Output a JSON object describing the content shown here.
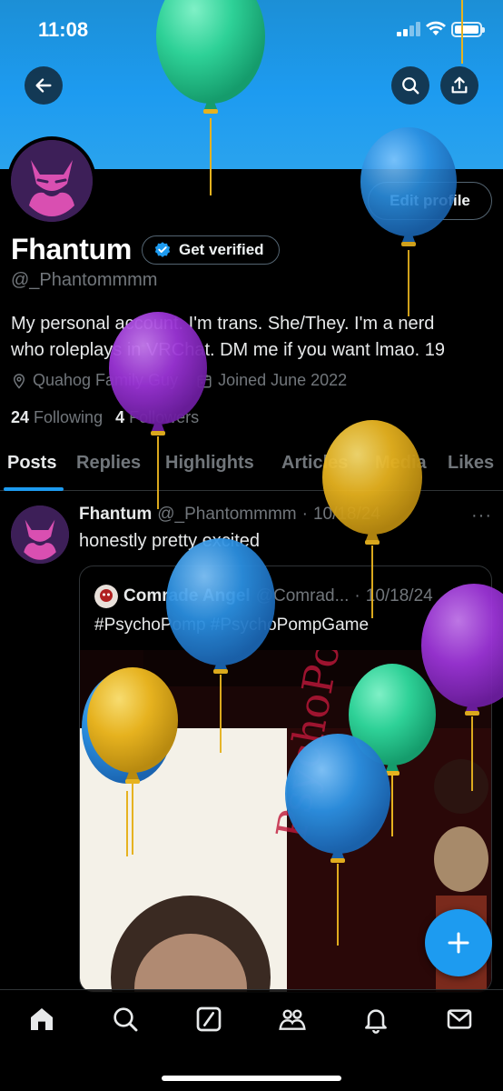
{
  "status_bar": {
    "time": "11:08"
  },
  "profile": {
    "name": "Fhantum",
    "get_verified": "Get verified",
    "edit_profile": "Edit profile",
    "handle": "@_Phantommmm",
    "bio_line1": "My personal account. I'm trans. She/They. I'm a nerd",
    "bio_line2": "who roleplays in VRChat. DM me if you want lmao. 19",
    "location": "Quahog Family Guy",
    "joined": "Joined June 2022",
    "following_count": "24",
    "following_label": "Following",
    "followers_count": "4",
    "followers_label": "Followers"
  },
  "tabs": [
    {
      "label": "Posts"
    },
    {
      "label": "Replies"
    },
    {
      "label": "Highlights"
    },
    {
      "label": "Articles"
    },
    {
      "label": "Media"
    },
    {
      "label": "Likes"
    }
  ],
  "post": {
    "name": "Fhantum",
    "handle": "@_Phantommmm",
    "separator": "·",
    "date": "10/18/24",
    "more": "···",
    "text": "honestly pretty excited",
    "quote": {
      "name": "Comrade Angel",
      "handle": "@Comrad...",
      "separator": "·",
      "date": "10/18/24",
      "text": "#PsychoPomp #PsychoPompGame"
    }
  },
  "icons": {
    "back": "arrow-left-icon",
    "search": "search-icon",
    "share": "share-icon",
    "verified": "verified-badge-icon",
    "location": "location-pin-icon",
    "calendar": "calendar-icon",
    "compose": "plus-icon",
    "nav": [
      "home-icon",
      "search-icon",
      "grok-icon",
      "communities-icon",
      "notifications-icon",
      "messages-icon"
    ]
  },
  "colors": {
    "accent": "#1d9bf0",
    "background": "#000000",
    "muted_text": "#71767b",
    "balloon_green": "#2ed197",
    "balloon_blue": "#2b8fe0",
    "balloon_purple": "#9b34d6",
    "balloon_yellow": "#e6b21f"
  }
}
